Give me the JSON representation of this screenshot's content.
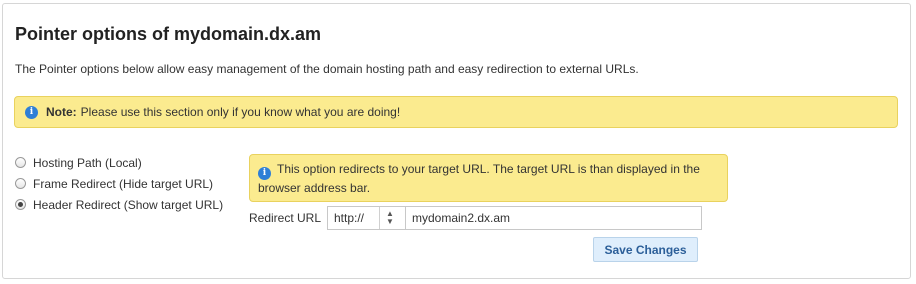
{
  "title": "Pointer options of mydomain.dx.am",
  "description": "The Pointer options below allow easy management of the domain hosting path and easy redirection to external URLs.",
  "note": {
    "icon": "info-icon",
    "label": "Note:",
    "text": "Please use this section only if you know what you are doing!"
  },
  "options": [
    {
      "label": "Hosting Path (Local)",
      "checked": false
    },
    {
      "label": "Frame Redirect (Hide target URL)",
      "checked": false
    },
    {
      "label": "Header Redirect (Show target URL)",
      "checked": true
    }
  ],
  "callout": {
    "icon": "info-icon",
    "text": "This option redirects to your target URL. The target URL is than displayed in the browser address bar."
  },
  "redirect": {
    "label": "Redirect URL",
    "protocol": "http://",
    "url": "mydomain2.dx.am"
  },
  "save_label": "Save Changes",
  "colors": {
    "note_bg": "#fbeb8f",
    "info_blue": "#2f7fd6",
    "button_bg": "#dfeefc",
    "button_text": "#2c5f99"
  }
}
